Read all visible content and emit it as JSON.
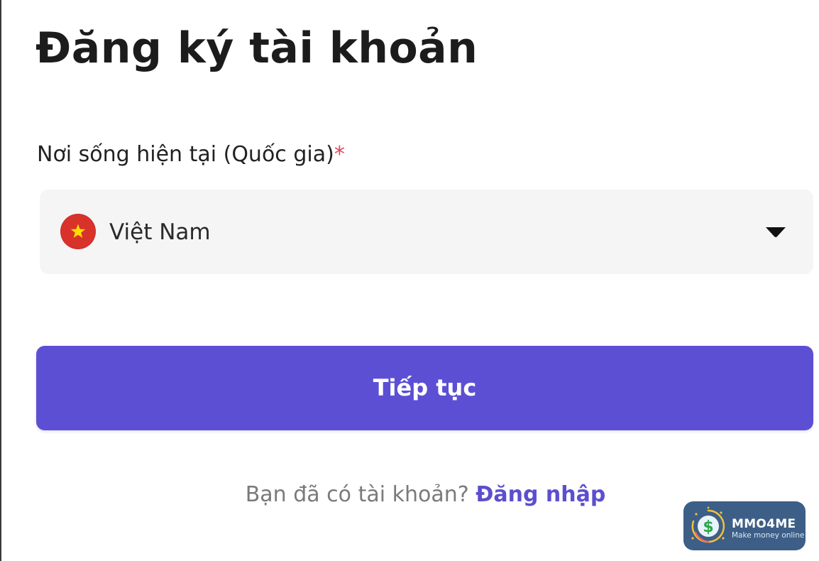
{
  "title": "Đăng ký tài khoản",
  "country_field": {
    "label": "Nơi sống hiện tại (Quốc gia)",
    "required_marker": "*",
    "selected_value": "Việt Nam",
    "flag_icon": "vietnam-flag-icon",
    "dropdown_icon": "caret-down-icon"
  },
  "continue_button": {
    "label": "Tiếp tục",
    "color": "#5d4fd4"
  },
  "login_prompt": {
    "text": "Bạn đã có tài khoản?",
    "link_label": "Đăng nhập",
    "link_color": "#5b4fcf"
  },
  "watermark": {
    "name": "MMO4ME",
    "tagline": "Make money online"
  },
  "colors": {
    "required_star": "#e0445a",
    "field_background": "#f5f5f5",
    "flag_red": "#d9322b",
    "flag_star": "#ffde00"
  }
}
